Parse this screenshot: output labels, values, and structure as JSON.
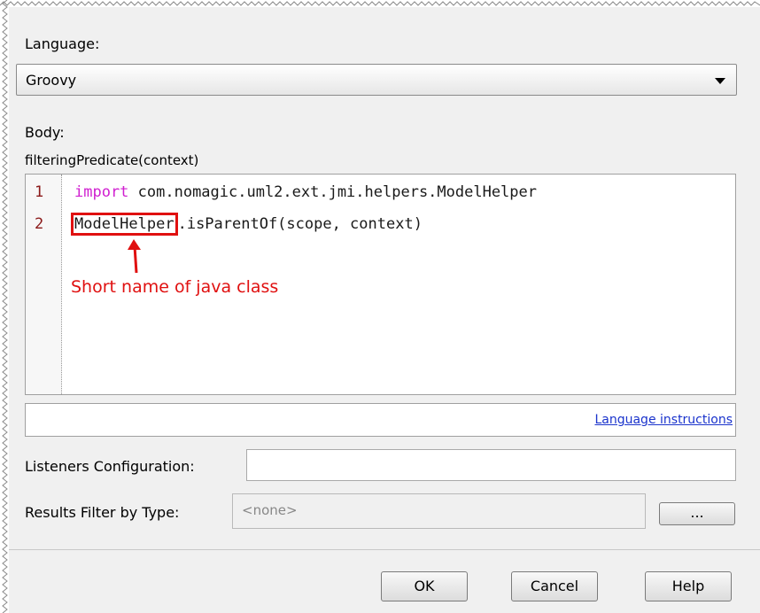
{
  "language": {
    "label": "Language:",
    "selected": "Groovy"
  },
  "body": {
    "label": "Body:",
    "signature": "filteringPredicate(context)"
  },
  "editor": {
    "lines": [
      {
        "number": "1",
        "keyword": "import",
        "rest": " com.nomagic.uml2.ext.jmi.helpers.ModelHelper"
      },
      {
        "number": "2",
        "highlighted": "ModelHelper",
        "rest": ".isParentOf(scope, context)"
      }
    ],
    "annotation": "Short name of java class",
    "annotation_color": "#e01010",
    "keyword_color": "#d020d0"
  },
  "language_instructions_link": "Language instructions",
  "listeners": {
    "label": "Listeners Configuration:",
    "value": ""
  },
  "results_filter": {
    "label": "Results Filter by Type:",
    "value": "<none>",
    "browse_label": "..."
  },
  "buttons": {
    "ok": "OK",
    "cancel": "Cancel",
    "help": "Help"
  }
}
